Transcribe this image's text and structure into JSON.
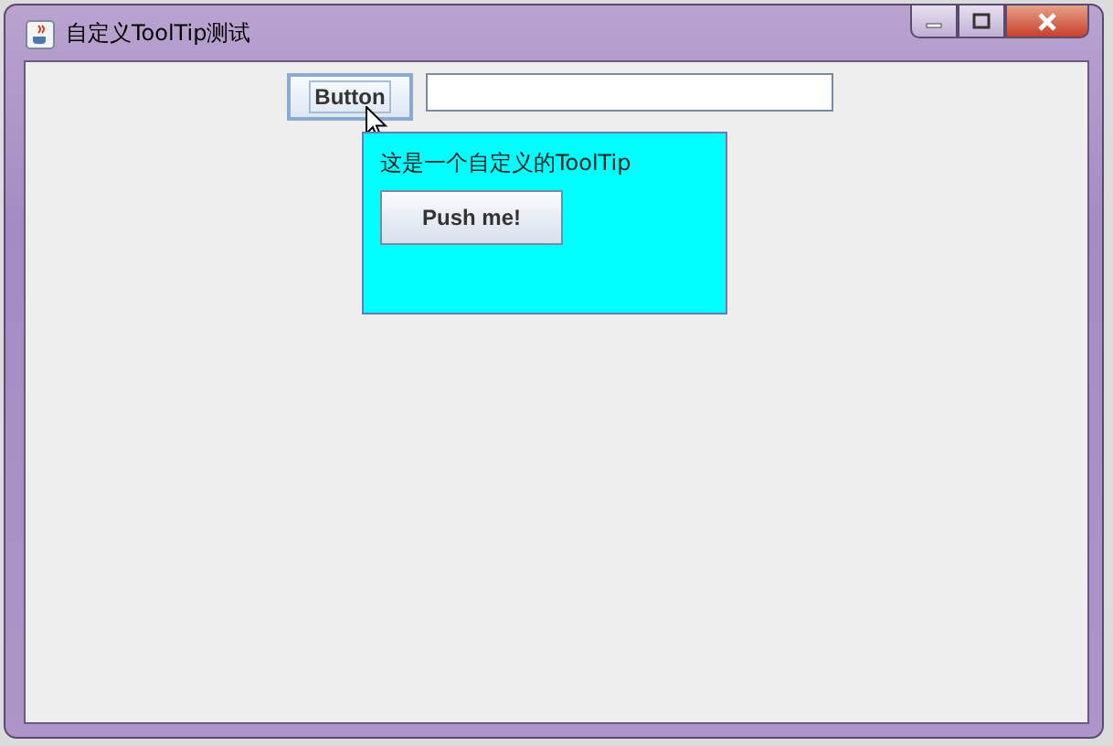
{
  "window": {
    "title": "自定义ToolTip测试"
  },
  "button": {
    "label": "Button",
    "focused": true,
    "hovered": true
  },
  "tooltip": {
    "text": "这是一个自定义的ToolTip",
    "button": {
      "label": "Push me!"
    }
  }
}
